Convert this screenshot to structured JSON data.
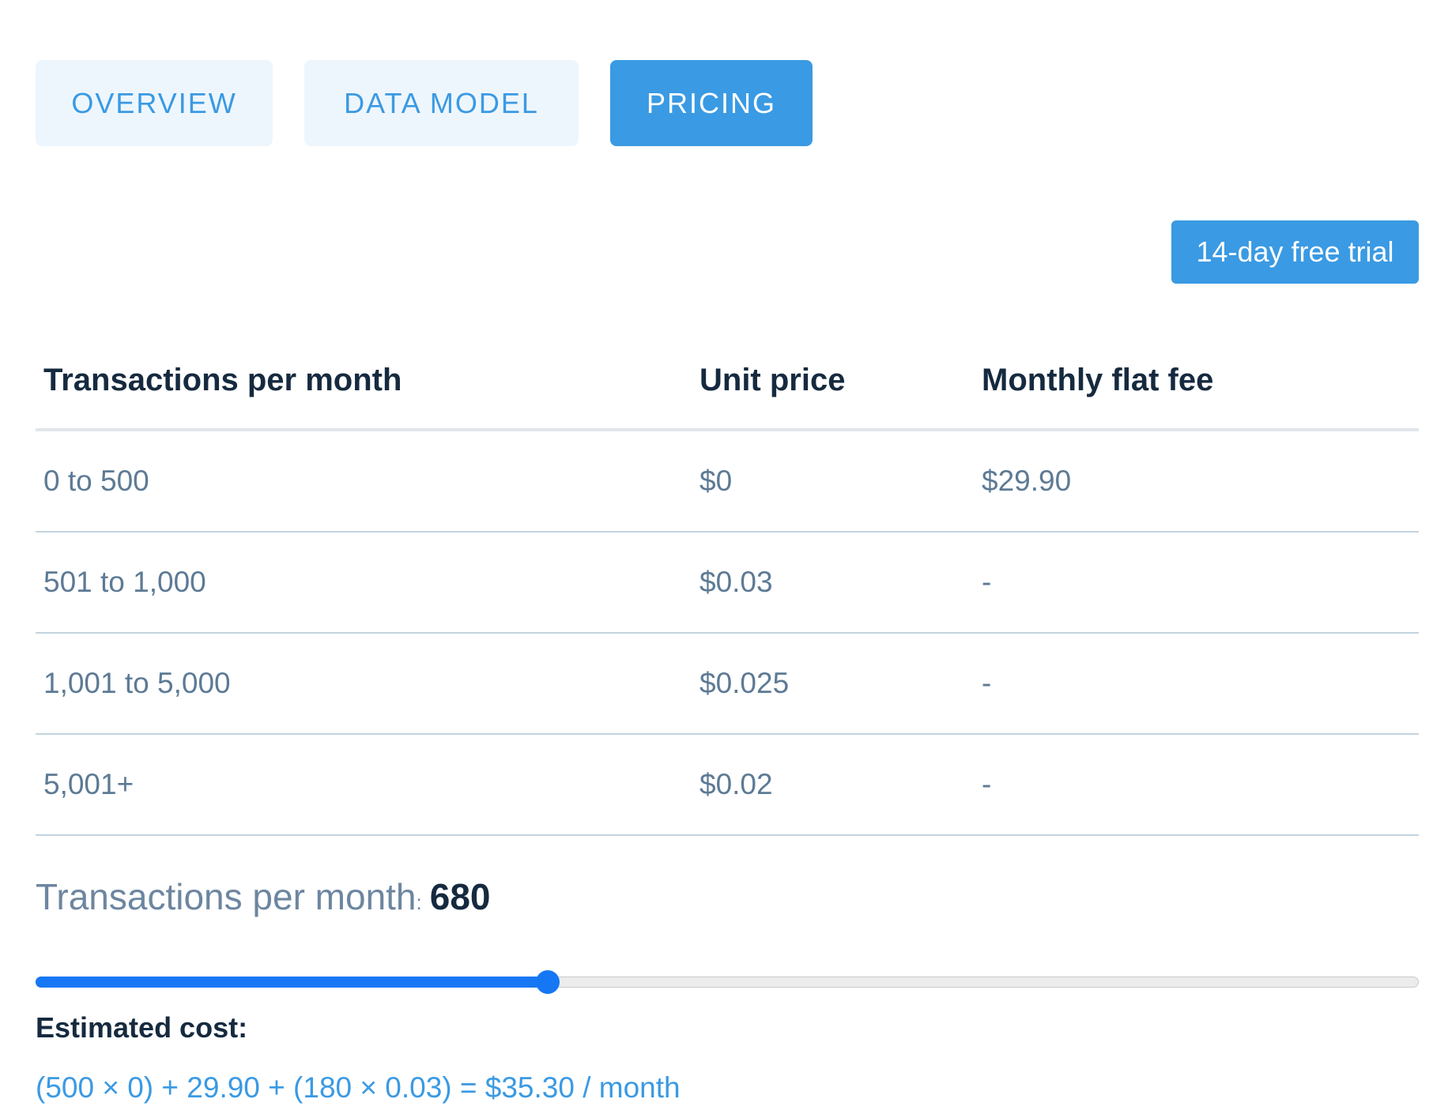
{
  "tabs": [
    {
      "label": "OVERVIEW",
      "active": false
    },
    {
      "label": "DATA MODEL",
      "active": false
    },
    {
      "label": "PRICING",
      "active": true
    }
  ],
  "trial_button": {
    "label": "14-day free trial"
  },
  "pricing_table": {
    "headers": [
      "Transactions per month",
      "Unit price",
      "Monthly flat fee"
    ],
    "rows": [
      [
        "0 to 500",
        "$0",
        "$29.90"
      ],
      [
        "501 to 1,000",
        "$0.03",
        "-"
      ],
      [
        "1,001 to 5,000",
        "$0.025",
        "-"
      ],
      [
        "5,001+",
        "$0.02",
        "-"
      ]
    ]
  },
  "counter": {
    "label": "Transactions per month",
    "separator": ":",
    "value": "680"
  },
  "slider": {
    "fraction": 0.37
  },
  "estimate": {
    "label": "Estimated cost:",
    "formula": "(500 × 0) + 29.90 + (180 × 0.03) = $35.30 / month"
  },
  "colors": {
    "accent": "#3a9ae3",
    "tab_inactive_bg": "#eef6fd",
    "slider_fill": "#1677f5",
    "heading_text": "#162a3f",
    "muted_text": "#5d7a95"
  }
}
